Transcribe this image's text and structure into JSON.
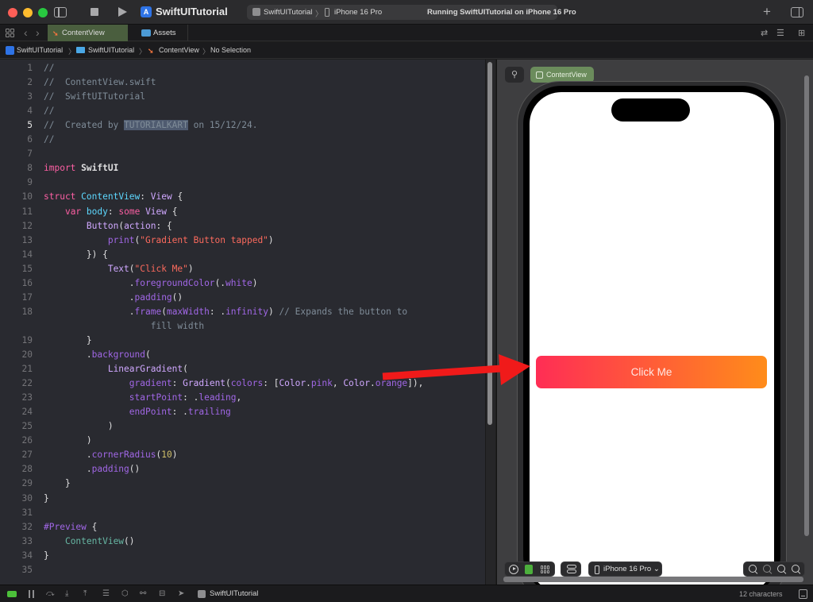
{
  "titlebar": {
    "project_name": "SwiftUITutorial",
    "scheme": "SwiftUITutorial",
    "scheme_separator": "〉",
    "run_destination": "iPhone 16 Pro",
    "activity_status": "Running SwiftUITutorial on iPhone 16 Pro",
    "add_label": "+",
    "icons": [
      "sidebar-toggle-icon",
      "stop-icon",
      "run-icon",
      "add-icon",
      "inspector-toggle-icon"
    ]
  },
  "tabs": [
    {
      "label": "ContentView",
      "icon": "swift-file-icon",
      "active": true
    },
    {
      "label": "Assets",
      "icon": "asset-catalog-icon",
      "active": false
    }
  ],
  "nav": {
    "back": "‹",
    "forward": "›"
  },
  "tabbar_right_icons": [
    "⇄",
    "☰",
    "⊞"
  ],
  "breadcrumb": [
    {
      "label": "SwiftUITutorial",
      "icon": "app-icon"
    },
    {
      "label": "SwiftUITutorial",
      "icon": "folder-icon"
    },
    {
      "label": "ContentView",
      "icon": "swift-file-icon"
    },
    {
      "label": "No Selection",
      "icon": null
    }
  ],
  "breadcrumb_sep": "〉",
  "editor": {
    "current_line": 5,
    "lines": [
      {
        "n": "1",
        "tokens": [
          [
            "c-comment",
            "//"
          ]
        ]
      },
      {
        "n": "2",
        "tokens": [
          [
            "c-comment",
            "//  ContentView.swift"
          ]
        ]
      },
      {
        "n": "3",
        "tokens": [
          [
            "c-comment",
            "//  SwiftUITutorial"
          ]
        ]
      },
      {
        "n": "4",
        "tokens": [
          [
            "c-comment",
            "//"
          ]
        ]
      },
      {
        "n": "5",
        "tokens": [
          [
            "c-comment",
            "//  Created by "
          ],
          [
            "c-highlight",
            "TUTORIALKART"
          ],
          [
            "c-comment",
            " on 15/12/24."
          ]
        ]
      },
      {
        "n": "6",
        "tokens": [
          [
            "c-comment",
            "//"
          ]
        ]
      },
      {
        "n": "7",
        "tokens": []
      },
      {
        "n": "8",
        "tokens": [
          [
            "c-kw",
            "import"
          ],
          [
            "c-plain",
            " SwiftUI"
          ]
        ]
      },
      {
        "n": "9",
        "tokens": []
      },
      {
        "n": "10",
        "tokens": [
          [
            "c-kw",
            "struct"
          ],
          [
            "c-white",
            " "
          ],
          [
            "c-decl",
            "ContentView"
          ],
          [
            "c-white",
            ": "
          ],
          [
            "c-type",
            "View"
          ],
          [
            "c-white",
            " {"
          ]
        ]
      },
      {
        "n": "11",
        "tokens": [
          [
            "c-white",
            "    "
          ],
          [
            "c-kw",
            "var"
          ],
          [
            "c-white",
            " "
          ],
          [
            "c-decl",
            "body"
          ],
          [
            "c-white",
            ": "
          ],
          [
            "c-kw",
            "some"
          ],
          [
            "c-white",
            " "
          ],
          [
            "c-type",
            "View"
          ],
          [
            "c-white",
            " {"
          ]
        ]
      },
      {
        "n": "12",
        "tokens": [
          [
            "c-white",
            "        "
          ],
          [
            "c-type",
            "Button"
          ],
          [
            "c-white",
            "("
          ],
          [
            "c-type",
            "action"
          ],
          [
            "c-white",
            ": {"
          ]
        ]
      },
      {
        "n": "13",
        "tokens": [
          [
            "c-white",
            "            "
          ],
          [
            "c-method",
            "print"
          ],
          [
            "c-white",
            "("
          ],
          [
            "c-str",
            "\"Gradient Button tapped\""
          ],
          [
            "c-white",
            ")"
          ]
        ]
      },
      {
        "n": "14",
        "tokens": [
          [
            "c-white",
            "        }) {"
          ]
        ]
      },
      {
        "n": "15",
        "tokens": [
          [
            "c-white",
            "            "
          ],
          [
            "c-type",
            "Text"
          ],
          [
            "c-white",
            "("
          ],
          [
            "c-str",
            "\"Click Me\""
          ],
          [
            "c-white",
            ")"
          ]
        ]
      },
      {
        "n": "16",
        "tokens": [
          [
            "c-white",
            "                ."
          ],
          [
            "c-method",
            "foregroundColor"
          ],
          [
            "c-white",
            "(."
          ],
          [
            "c-method",
            "white"
          ],
          [
            "c-white",
            ")"
          ]
        ]
      },
      {
        "n": "17",
        "tokens": [
          [
            "c-white",
            "                ."
          ],
          [
            "c-method",
            "padding"
          ],
          [
            "c-white",
            "()"
          ]
        ]
      },
      {
        "n": "18",
        "tokens": [
          [
            "c-white",
            "                ."
          ],
          [
            "c-method",
            "frame"
          ],
          [
            "c-white",
            "("
          ],
          [
            "c-method",
            "maxWidth"
          ],
          [
            "c-white",
            ": ."
          ],
          [
            "c-method",
            "infinity"
          ],
          [
            "c-white",
            ") "
          ],
          [
            "c-comment",
            "// Expands the button to"
          ]
        ]
      },
      {
        "n": "",
        "tokens": [
          [
            "c-comment",
            "                    fill width"
          ]
        ]
      },
      {
        "n": "19",
        "tokens": [
          [
            "c-white",
            "        }"
          ]
        ]
      },
      {
        "n": "20",
        "tokens": [
          [
            "c-white",
            "        ."
          ],
          [
            "c-method",
            "background"
          ],
          [
            "c-white",
            "("
          ]
        ]
      },
      {
        "n": "21",
        "tokens": [
          [
            "c-white",
            "            "
          ],
          [
            "c-type",
            "LinearGradient"
          ],
          [
            "c-white",
            "("
          ]
        ]
      },
      {
        "n": "22",
        "tokens": [
          [
            "c-white",
            "                "
          ],
          [
            "c-method",
            "gradient"
          ],
          [
            "c-white",
            ": "
          ],
          [
            "c-type",
            "Gradient"
          ],
          [
            "c-white",
            "("
          ],
          [
            "c-method",
            "colors"
          ],
          [
            "c-white",
            ": ["
          ],
          [
            "c-type",
            "Color"
          ],
          [
            "c-white",
            "."
          ],
          [
            "c-method",
            "pink"
          ],
          [
            "c-white",
            ", "
          ],
          [
            "c-type",
            "Color"
          ],
          [
            "c-white",
            "."
          ],
          [
            "c-method",
            "orange"
          ],
          [
            "c-white",
            "]),"
          ]
        ]
      },
      {
        "n": "23",
        "tokens": [
          [
            "c-white",
            "                "
          ],
          [
            "c-method",
            "startPoint"
          ],
          [
            "c-white",
            ": ."
          ],
          [
            "c-method",
            "leading"
          ],
          [
            "c-white",
            ","
          ]
        ]
      },
      {
        "n": "24",
        "tokens": [
          [
            "c-white",
            "                "
          ],
          [
            "c-method",
            "endPoint"
          ],
          [
            "c-white",
            ": ."
          ],
          [
            "c-method",
            "trailing"
          ]
        ]
      },
      {
        "n": "25",
        "tokens": [
          [
            "c-white",
            "            )"
          ]
        ]
      },
      {
        "n": "26",
        "tokens": [
          [
            "c-white",
            "        )"
          ]
        ]
      },
      {
        "n": "27",
        "tokens": [
          [
            "c-white",
            "        ."
          ],
          [
            "c-method",
            "cornerRadius"
          ],
          [
            "c-white",
            "("
          ],
          [
            "c-num",
            "10"
          ],
          [
            "c-white",
            ")"
          ]
        ]
      },
      {
        "n": "28",
        "tokens": [
          [
            "c-white",
            "        ."
          ],
          [
            "c-method",
            "padding"
          ],
          [
            "c-white",
            "()"
          ]
        ]
      },
      {
        "n": "29",
        "tokens": [
          [
            "c-white",
            "    }"
          ]
        ]
      },
      {
        "n": "30",
        "tokens": [
          [
            "c-white",
            "}"
          ]
        ]
      },
      {
        "n": "31",
        "tokens": []
      },
      {
        "n": "32",
        "tokens": [
          [
            "c-method",
            "#Preview"
          ],
          [
            "c-white",
            " {"
          ]
        ]
      },
      {
        "n": "33",
        "tokens": [
          [
            "c-white",
            "    "
          ],
          [
            "c-proj",
            "ContentView"
          ],
          [
            "c-white",
            "()"
          ]
        ]
      },
      {
        "n": "34",
        "tokens": [
          [
            "c-white",
            "}"
          ]
        ]
      },
      {
        "n": "35",
        "tokens": []
      }
    ]
  },
  "preview": {
    "pin_icon": "⚲",
    "view_label": "ContentView",
    "button_label": "Click Me",
    "gradient_colors": [
      "#ff2d55",
      "#ff8c1a"
    ],
    "device_menu": "iPhone 16 Pro",
    "device_menu_chevron": "⌄",
    "annotation_arrow_color": "#f01a1a"
  },
  "statusbar": {
    "app_label": "SwiftUITutorial",
    "char_count": "12 characters",
    "icons": [
      "debug-area-toggle-icon",
      "pause-icon",
      "step-over-icon",
      "step-into-icon",
      "step-out-icon",
      "view-hierarchy-icon",
      "memory-graph-icon",
      "environment-icon",
      "simulate-location-icon"
    ]
  }
}
